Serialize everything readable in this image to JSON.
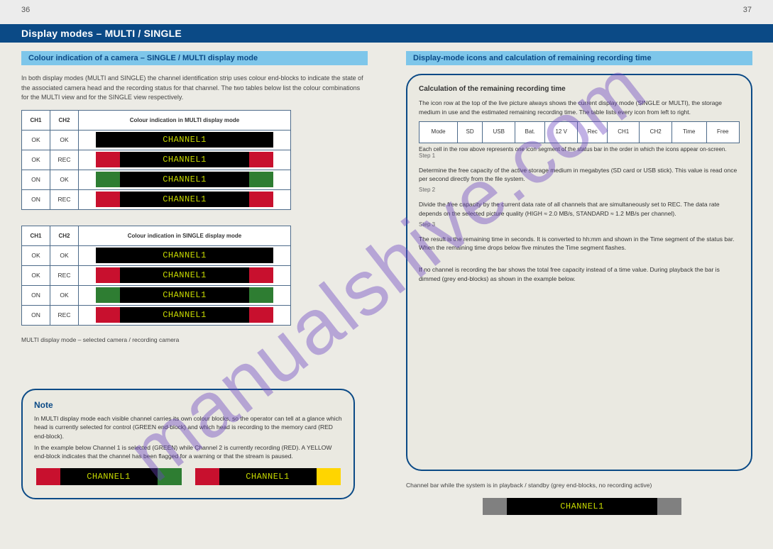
{
  "watermark": "manualshive.com",
  "page_left_num": "36",
  "page_right_num": "37",
  "topbar_title": "Display modes – MULTI / SINGLE",
  "left_section_header": "Colour indication of a camera – SINGLE / MULTI display mode",
  "intro_text": "In both display modes (MULTI and SINGLE) the channel identification strip uses colour end-blocks to indicate the state of the associated camera head and the recording status for that channel. The two tables below list the colour combinations for the MULTI view and for the SINGLE view respectively.",
  "tables": {
    "multi": {
      "header_ch": "CH1",
      "header_ch2": "CH2",
      "header_label": "Colour indication in MULTI display mode",
      "rows": [
        {
          "c1": "OK",
          "c2": "OK",
          "left": "black",
          "right": "black"
        },
        {
          "c1": "OK",
          "c2": "REC",
          "left": "red",
          "right": "red"
        },
        {
          "c1": "ON",
          "c2": "OK",
          "left": "green",
          "right": "green"
        },
        {
          "c1": "ON",
          "c2": "REC",
          "left": "red",
          "right": "red"
        }
      ]
    },
    "single": {
      "header_label": "Colour indication in SINGLE display mode",
      "rows": [
        {
          "c1": "OK",
          "c2": "OK",
          "left": "black",
          "right": "black"
        },
        {
          "c1": "OK",
          "c2": "REC",
          "left": "red",
          "right": "red"
        },
        {
          "c1": "ON",
          "c2": "OK",
          "left": "green",
          "right": "green"
        },
        {
          "c1": "ON",
          "c2": "REC",
          "left": "red",
          "right": "red"
        }
      ]
    }
  },
  "channel_label": "CHANNEL1",
  "multi_note_label": "MULTI display mode – selected camera / recording camera",
  "note": {
    "title": "Note",
    "p1": "In MULTI display mode each visible channel carries its own colour blocks, so the operator can tell at a glance which head is currently selected for control (GREEN end-block) and which head is recording to the memory card (RED end-block).",
    "p2": "In the example below Channel 1 is selected (GREEN) while Channel 2 is currently recording (RED). A YELLOW end-block indicates that the channel has been flagged for a warning or that the stream is paused."
  },
  "right_section_header": "Display-mode icons and calculation of remaining recording time",
  "right_intro": "The icon row at the top of the live picture always shows the current display mode (SINGLE or MULTI), the storage medium in use and the estimated remaining recording time. The table lists every icon from left to right.",
  "calc": {
    "heading": "Calculation of the remaining recording time",
    "cols": [
      "Mode",
      "SD",
      "USB",
      "Bat.",
      "12 V",
      "Rec",
      "CH1",
      "CH2",
      "Time",
      "Free"
    ],
    "data_note": "Each cell in the row above represents one icon segment of the status bar in the order in which the icons appear on-screen.",
    "step1_num": "Step 1",
    "step1": "Determine the free capacity of the active storage medium in megabytes (SD card or USB stick). This value is read once per second directly from the file system.",
    "step2_num": "Step 2",
    "step2": "Divide the free capacity by the current data rate of all channels that are simultaneously set to REC. The data rate depends on the selected picture quality (HIGH ≈ 2.0 MB/s, STANDARD ≈ 1.2 MB/s per channel).",
    "step3_num": "Step 3",
    "step3": "The result is the remaining time in seconds. It is converted to hh:mm and shown in the Time segment of the status bar. When the remaining time drops below five minutes the Time segment flashes.",
    "closing": "If no channel is recording the bar shows the total free capacity instead of a time value. During playback the bar is dimmed (grey end-blocks) as shown in the example below."
  },
  "bottom_caption": "Channel bar while the system is in playback / standby (grey end-blocks, no recording active)"
}
